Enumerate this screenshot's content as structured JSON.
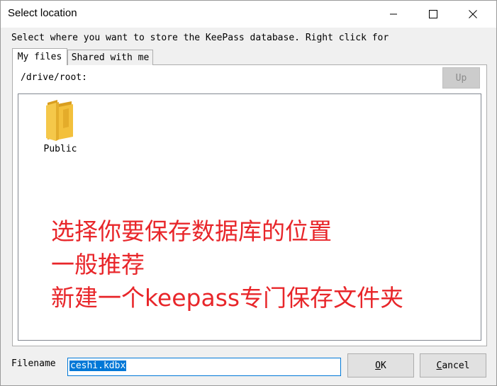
{
  "window": {
    "title": "Select location",
    "controls": {
      "minimize_icon": "minimize-icon",
      "maximize_icon": "maximize-icon",
      "close_icon": "close-icon"
    }
  },
  "description": "Select where you want to store the KeePass database. Right click for",
  "tabs": [
    {
      "label": "My files",
      "active": true
    },
    {
      "label": "Shared with me",
      "active": false
    }
  ],
  "browser": {
    "path": "/drive/root:",
    "up_label": "Up",
    "items": [
      {
        "name": "Public",
        "icon": "folder-icon"
      }
    ]
  },
  "annotation": {
    "color": "#e8262a",
    "lines": [
      "选择你要保存数据库的位置",
      "一般推荐",
      "新建一个keepass专门保存文件夹"
    ]
  },
  "filename": {
    "label": "Filename",
    "value": "ceshi.kdbx"
  },
  "buttons": {
    "ok": "OK",
    "cancel": "Cancel"
  }
}
